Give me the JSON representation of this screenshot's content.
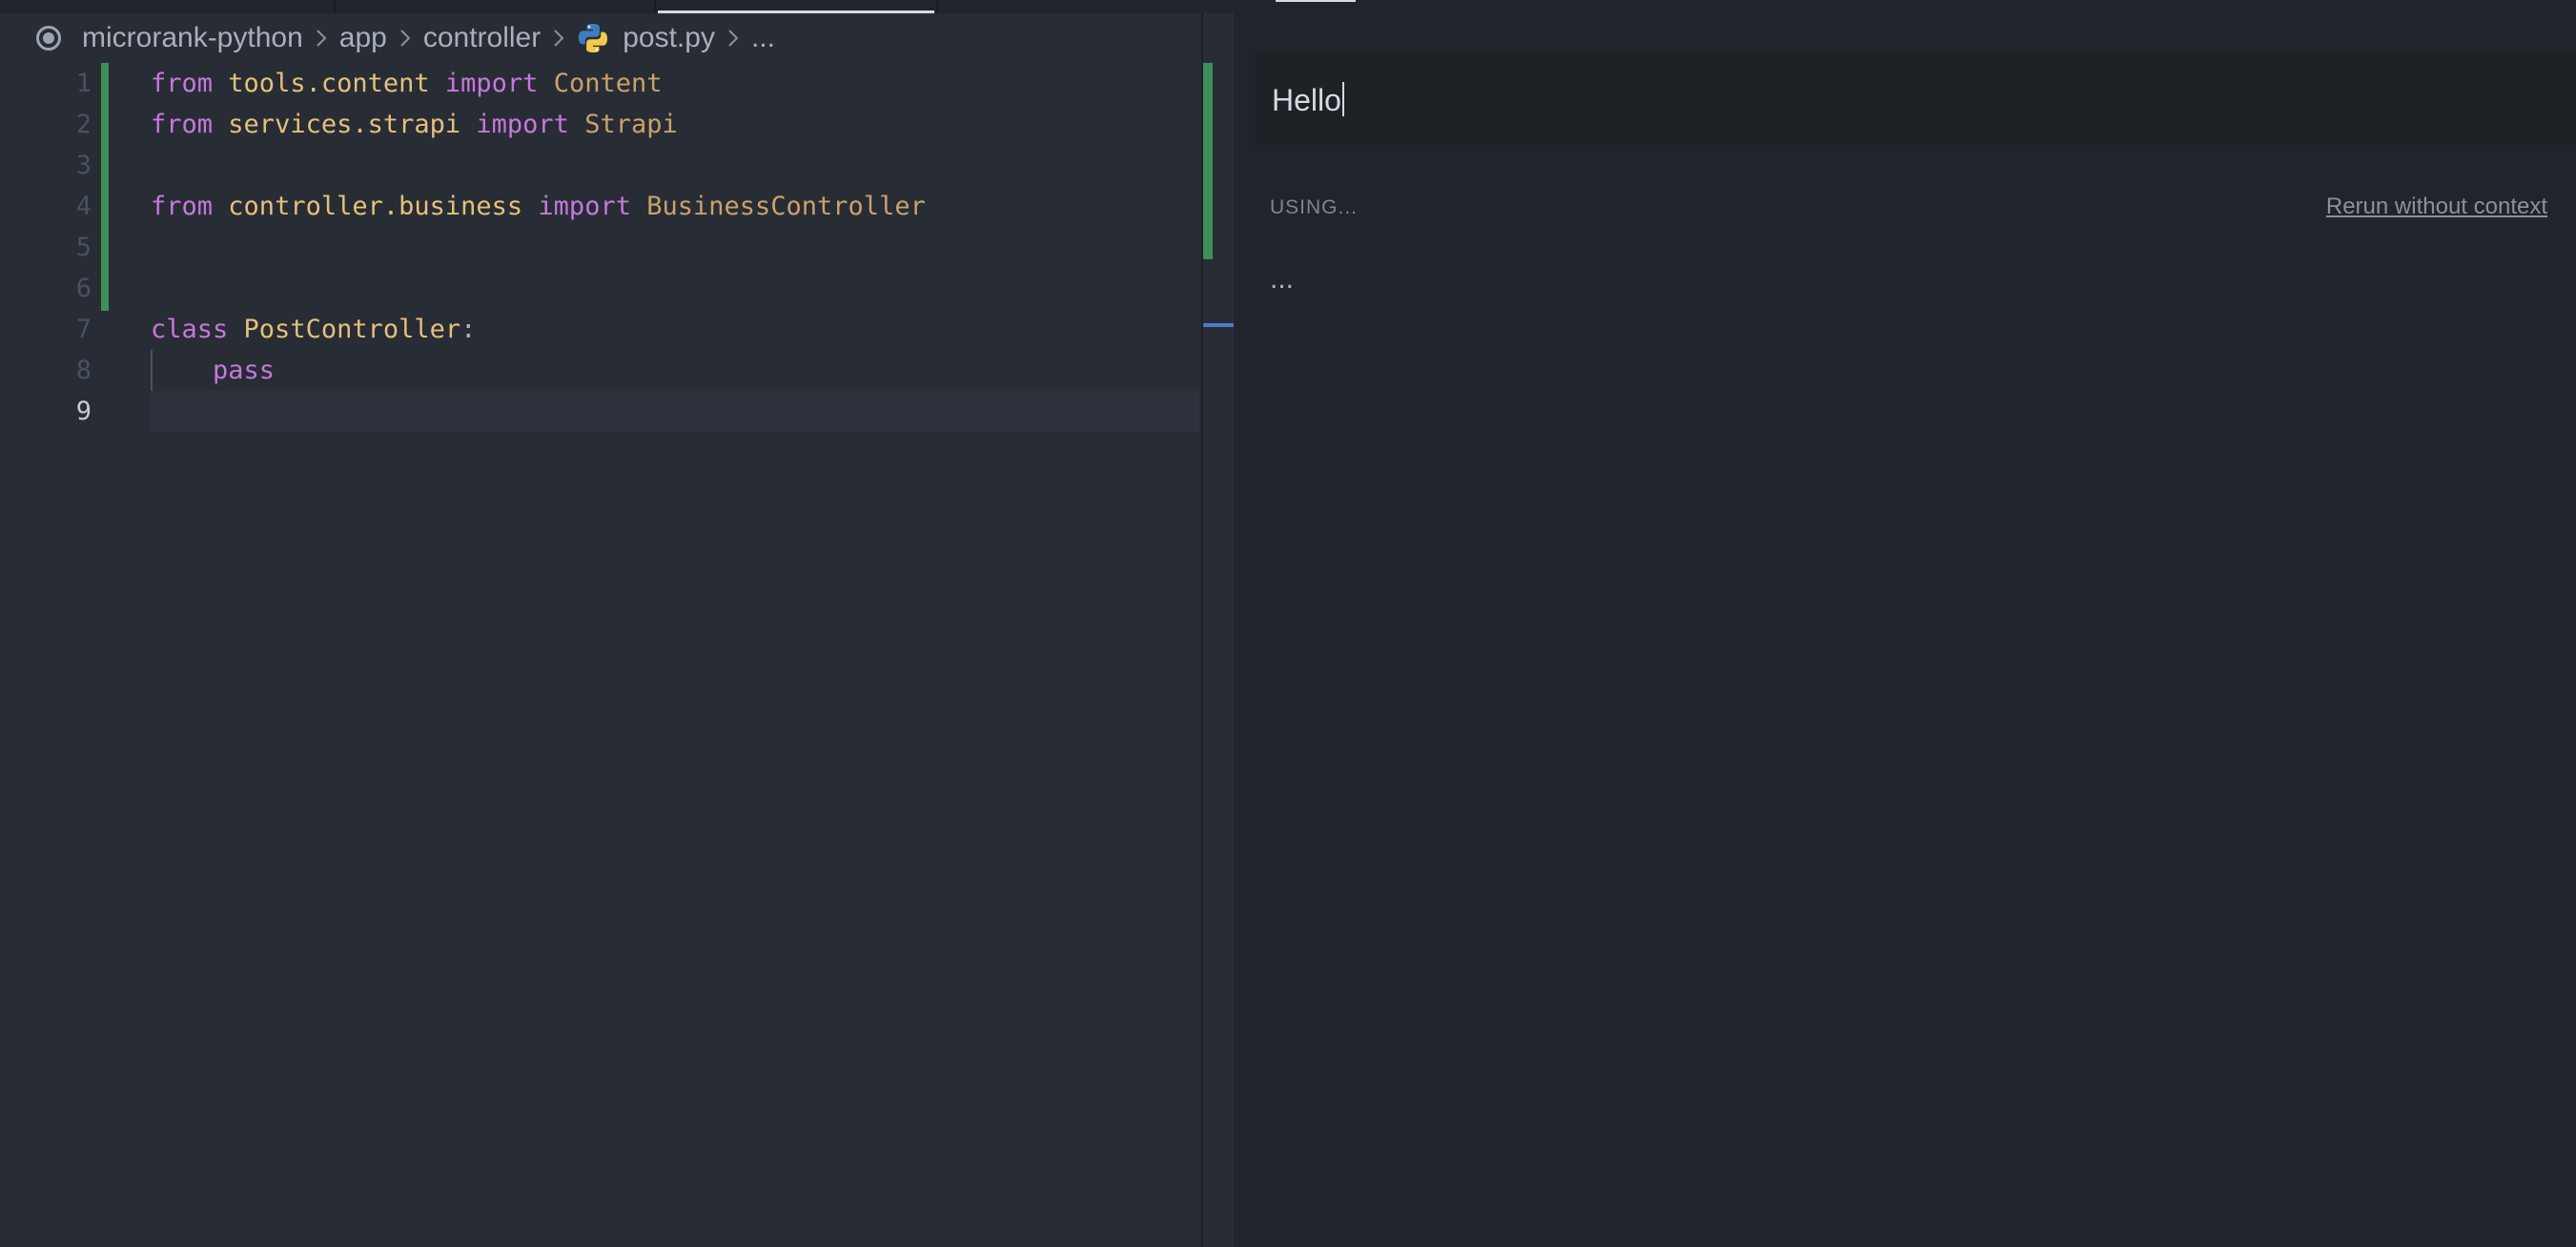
{
  "breadcrumb": {
    "items": [
      "microrank-python",
      "app",
      "controller",
      "post.py",
      "..."
    ]
  },
  "editor": {
    "line_numbers": [
      "1",
      "2",
      "3",
      "4",
      "5",
      "6",
      "7",
      "8",
      "9"
    ],
    "active_line": "9",
    "lines": [
      [
        {
          "t": "kw",
          "v": "from"
        },
        {
          "t": "plain",
          "v": " "
        },
        {
          "t": "mod",
          "v": "tools.content"
        },
        {
          "t": "plain",
          "v": " "
        },
        {
          "t": "kw",
          "v": "import"
        },
        {
          "t": "plain",
          "v": " "
        },
        {
          "t": "cls",
          "v": "Content"
        }
      ],
      [
        {
          "t": "kw",
          "v": "from"
        },
        {
          "t": "plain",
          "v": " "
        },
        {
          "t": "mod",
          "v": "services.strapi"
        },
        {
          "t": "plain",
          "v": " "
        },
        {
          "t": "kw",
          "v": "import"
        },
        {
          "t": "plain",
          "v": " "
        },
        {
          "t": "cls",
          "v": "Strapi"
        }
      ],
      [],
      [
        {
          "t": "kw",
          "v": "from"
        },
        {
          "t": "plain",
          "v": " "
        },
        {
          "t": "mod",
          "v": "controller.business"
        },
        {
          "t": "plain",
          "v": " "
        },
        {
          "t": "kw",
          "v": "import"
        },
        {
          "t": "plain",
          "v": " "
        },
        {
          "t": "cls",
          "v": "BusinessController"
        }
      ],
      [],
      [],
      [
        {
          "t": "kw",
          "v": "class"
        },
        {
          "t": "plain",
          "v": " "
        },
        {
          "t": "mod",
          "v": "PostController"
        },
        {
          "t": "plain",
          "v": ":"
        }
      ],
      [
        {
          "t": "plain",
          "v": "    "
        },
        {
          "t": "kw",
          "v": "pass"
        }
      ],
      []
    ]
  },
  "chat": {
    "prompt_value": "Hello",
    "using_label": "USING...",
    "rerun_label": "Rerun without context",
    "response_text": "..."
  },
  "colors": {
    "keyword": "#c678dd",
    "module": "#e5c07b",
    "class_name": "#c9a26b",
    "added_lines": "#3f8f5a",
    "scroll_marker": "#4d78cc"
  },
  "icons": {
    "source_control": "circle-dot-icon",
    "separator": "chevron-right-icon",
    "file_type": "python-icon"
  }
}
